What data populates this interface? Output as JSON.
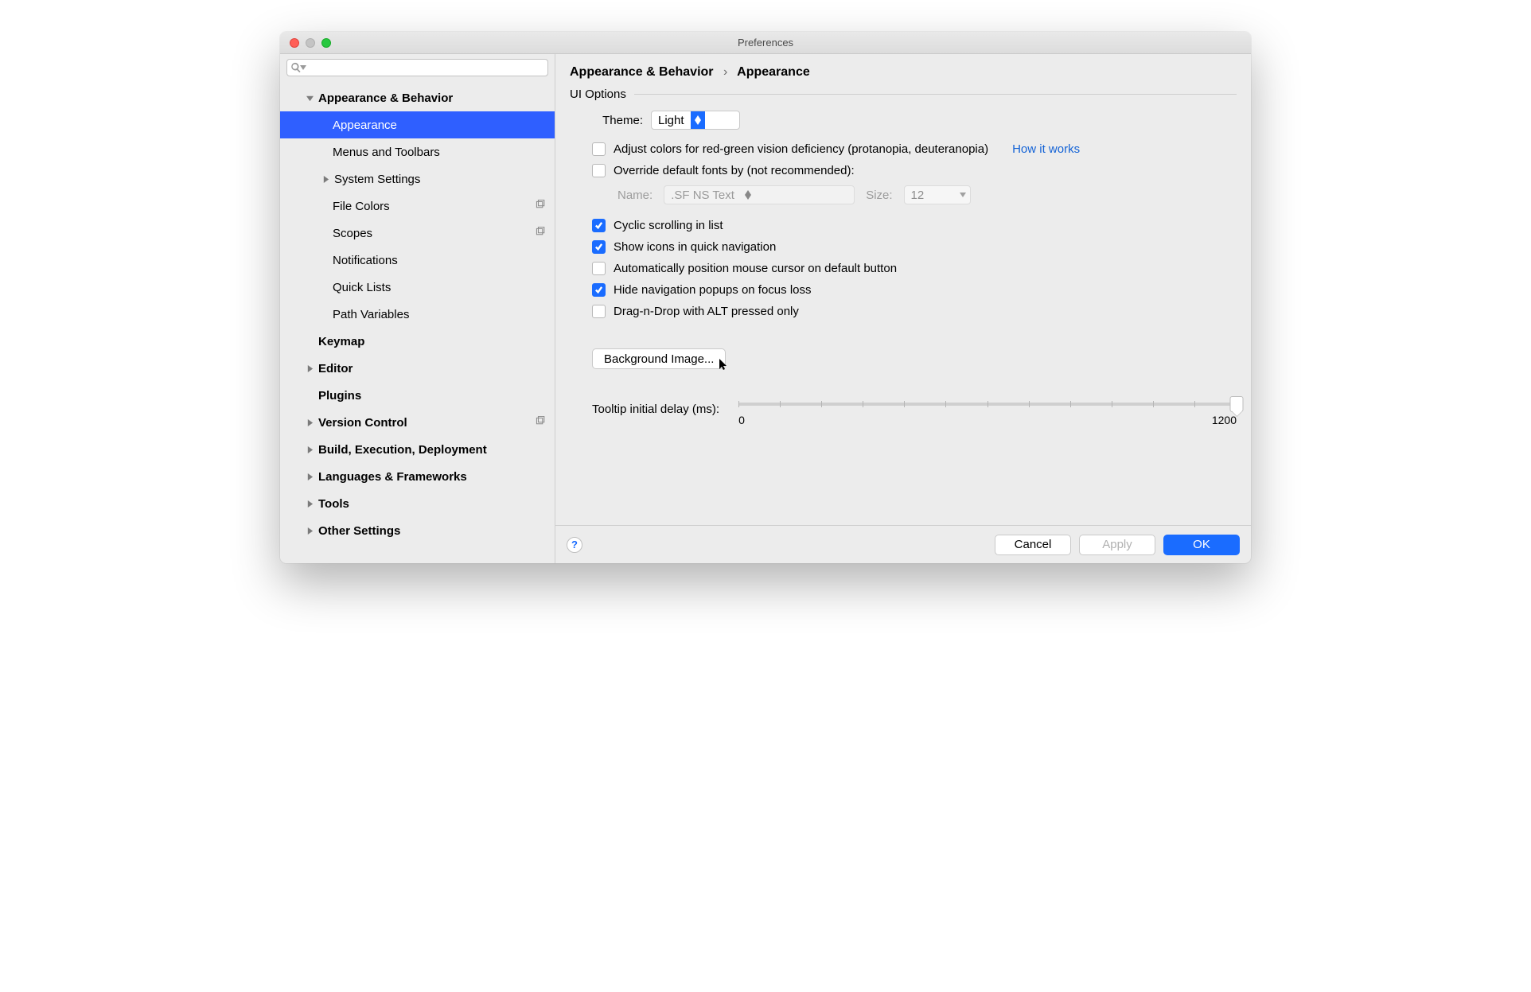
{
  "window": {
    "title": "Preferences"
  },
  "search": {
    "placeholder": ""
  },
  "sidebar": {
    "items": [
      {
        "label": "Appearance & Behavior",
        "level": 1,
        "expanded": true
      },
      {
        "label": "Appearance",
        "level": 2,
        "selected": true
      },
      {
        "label": "Menus and Toolbars",
        "level": 2
      },
      {
        "label": "System Settings",
        "level": 2,
        "hasChildren": true
      },
      {
        "label": "File Colors",
        "level": 2,
        "shareIcon": true
      },
      {
        "label": "Scopes",
        "level": 2,
        "shareIcon": true
      },
      {
        "label": "Notifications",
        "level": 2
      },
      {
        "label": "Quick Lists",
        "level": 2
      },
      {
        "label": "Path Variables",
        "level": 2
      },
      {
        "label": "Keymap",
        "level": 1
      },
      {
        "label": "Editor",
        "level": 1,
        "hasChildren": true
      },
      {
        "label": "Plugins",
        "level": 1
      },
      {
        "label": "Version Control",
        "level": 1,
        "hasChildren": true,
        "shareIcon": true
      },
      {
        "label": "Build, Execution, Deployment",
        "level": 1,
        "hasChildren": true
      },
      {
        "label": "Languages & Frameworks",
        "level": 1,
        "hasChildren": true
      },
      {
        "label": "Tools",
        "level": 1,
        "hasChildren": true
      },
      {
        "label": "Other Settings",
        "level": 1,
        "hasChildren": true
      }
    ]
  },
  "breadcrumb": {
    "root": "Appearance & Behavior",
    "leaf": "Appearance"
  },
  "section": {
    "ui_options": "UI Options"
  },
  "theme": {
    "label": "Theme:",
    "value": "Light"
  },
  "checks": {
    "adjust_colors": "Adjust colors for red-green vision deficiency (protanopia, deuteranopia)",
    "how_it_works": "How it works",
    "override_fonts": "Override default fonts by (not recommended):",
    "cyclic_scroll": "Cyclic scrolling in list",
    "show_icons": "Show icons in quick navigation",
    "auto_mouse": "Automatically position mouse cursor on default button",
    "hide_nav": "Hide navigation popups on focus loss",
    "drag_alt": "Drag-n-Drop with ALT pressed only"
  },
  "font": {
    "name_label": "Name:",
    "name_value": ".SF NS Text",
    "size_label": "Size:",
    "size_value": "12"
  },
  "bg_button": "Background Image...",
  "tooltip": {
    "label": "Tooltip initial delay (ms):",
    "min": "0",
    "max": "1200"
  },
  "footer": {
    "cancel": "Cancel",
    "apply": "Apply",
    "ok": "OK"
  }
}
